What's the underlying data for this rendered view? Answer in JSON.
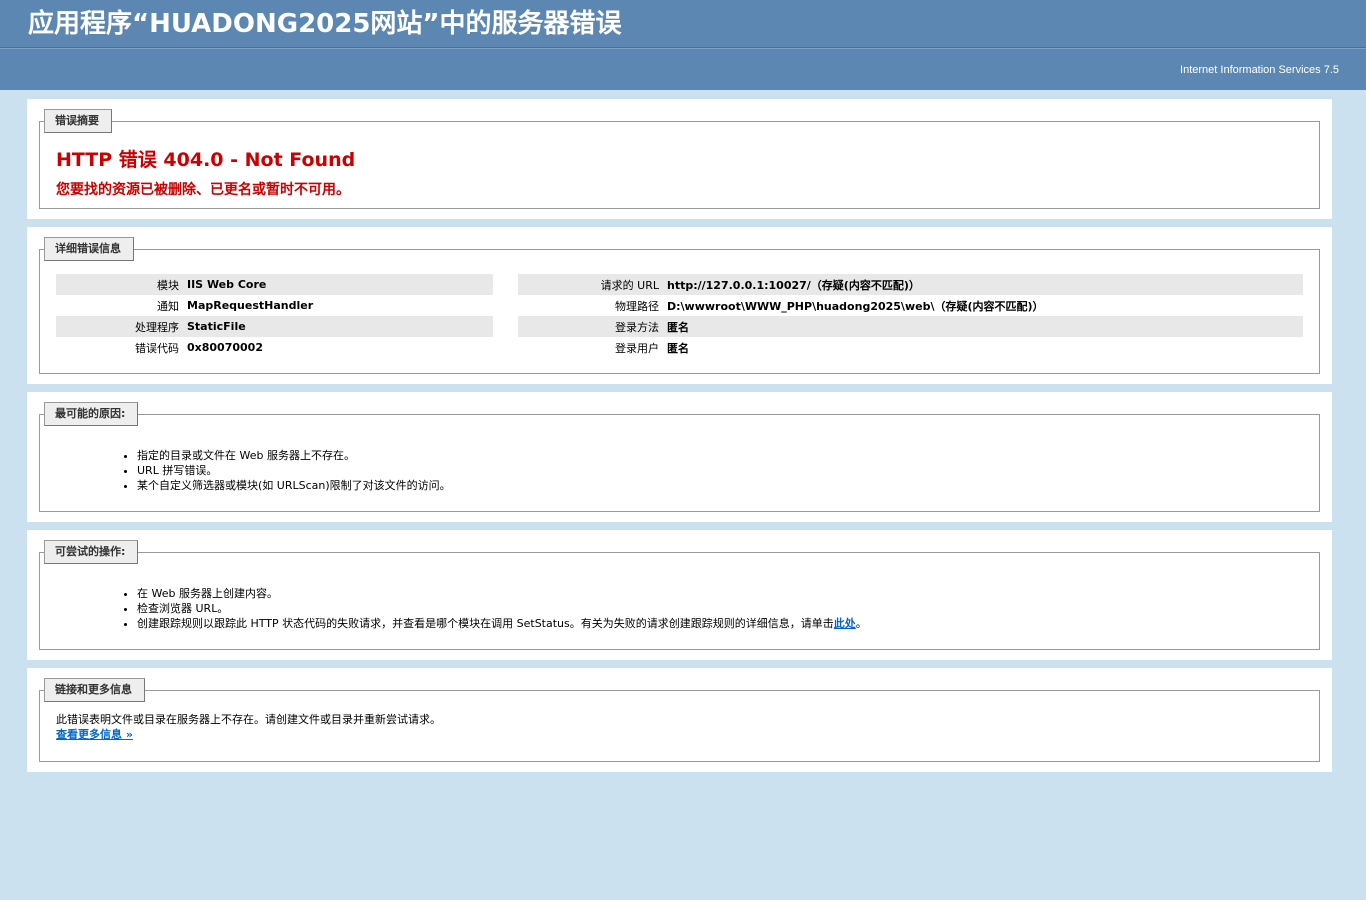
{
  "header": {
    "title": "应用程序“HUADONG2025网站”中的服务器错误",
    "server": "Internet Information Services 7.5"
  },
  "summary": {
    "legend": "错误摘要",
    "error_title": "HTTP 错误 404.0 - Not Found",
    "error_message": "您要找的资源已被删除、已更名或暂时不可用。"
  },
  "details": {
    "legend": "详细错误信息",
    "left": [
      {
        "key": "模块",
        "value": "IIS Web Core"
      },
      {
        "key": "通知",
        "value": "MapRequestHandler"
      },
      {
        "key": "处理程序",
        "value": "StaticFile"
      },
      {
        "key": "错误代码",
        "value": "0x80070002"
      }
    ],
    "right": [
      {
        "key": "请求的 URL",
        "value": "http://127.0.0.1:10027/（存疑(内容不匹配)）"
      },
      {
        "key": "物理路径",
        "value": "D:\\wwwroot\\WWW_PHP\\huadong2025\\web\\（存疑(内容不匹配)）"
      },
      {
        "key": "登录方法",
        "value": "匿名"
      },
      {
        "key": "登录用户",
        "value": "匿名"
      }
    ]
  },
  "causes": {
    "legend": "最可能的原因:",
    "items": [
      "指定的目录或文件在 Web 服务器上不存在。",
      "URL 拼写错误。",
      "某个自定义筛选器或模块(如 URLScan)限制了对该文件的访问。"
    ]
  },
  "actions": {
    "legend": "可尝试的操作:",
    "items": [
      "在 Web 服务器上创建内容。",
      "检查浏览器 URL。"
    ],
    "last_item_text": "创建跟踪规则以跟踪此 HTTP 状态代码的失败请求，并查看是哪个模块在调用 SetStatus。有关为失败的请求创建跟踪规则的详细信息，请单击",
    "last_item_link": "此处",
    "last_item_end": "。"
  },
  "more": {
    "legend": "链接和更多信息",
    "text": "此错误表明文件或目录在服务器上不存在。请创建文件或目录并重新尝试请求。",
    "link": "查看更多信息 »"
  }
}
